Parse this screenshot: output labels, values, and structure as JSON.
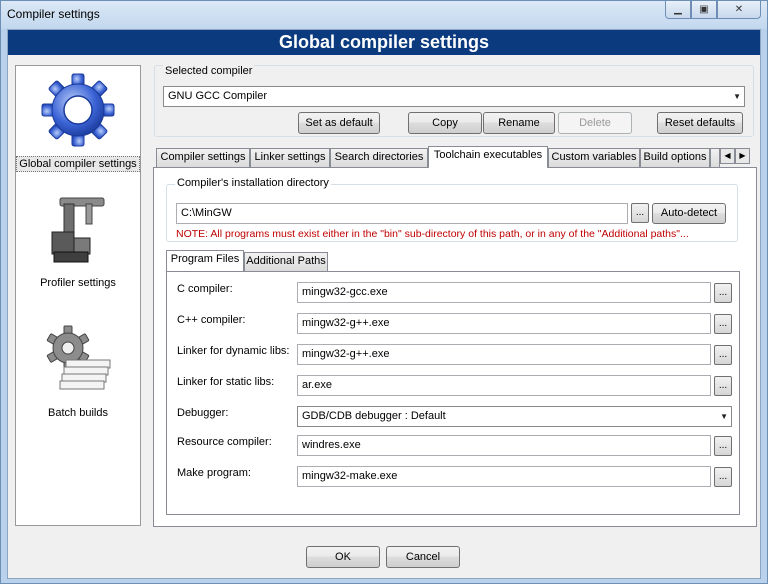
{
  "window": {
    "title": "Compiler settings"
  },
  "titlebar": {
    "minimize": "▭",
    "maximize": "□",
    "close": "✕"
  },
  "header": {
    "title": "Global compiler settings"
  },
  "sidebar": {
    "items": [
      {
        "label": "Global compiler settings",
        "icon": "gear-icon",
        "selected": true
      },
      {
        "label": "Profiler settings",
        "icon": "profiler-icon",
        "selected": false
      },
      {
        "label": "Batch builds",
        "icon": "batch-builds-icon",
        "selected": false
      }
    ]
  },
  "selected_compiler": {
    "group_label": "Selected compiler",
    "value": "GNU GCC Compiler",
    "buttons": {
      "set_default": "Set as default",
      "copy": "Copy",
      "rename": "Rename",
      "delete": "Delete",
      "reset": "Reset defaults"
    }
  },
  "tabs": [
    {
      "label": "Compiler settings",
      "active": false
    },
    {
      "label": "Linker settings",
      "active": false
    },
    {
      "label": "Search directories",
      "active": false
    },
    {
      "label": "Toolchain executables",
      "active": true
    },
    {
      "label": "Custom variables",
      "active": false
    },
    {
      "label": "Build options",
      "active": false
    }
  ],
  "install": {
    "group_label": "Compiler's installation directory",
    "path": "C:\\MinGW",
    "browse": "...",
    "autodetect": "Auto-detect",
    "note": "NOTE: All programs must exist either in the \"bin\" sub-directory of this path, or in any of the \"Additional paths\"..."
  },
  "subtabs": [
    {
      "label": "Program Files",
      "active": true
    },
    {
      "label": "Additional Paths",
      "active": false
    }
  ],
  "programs": {
    "c_compiler": {
      "label": "C compiler:",
      "value": "mingw32-gcc.exe"
    },
    "cpp_compiler": {
      "label": "C++ compiler:",
      "value": "mingw32-g++.exe"
    },
    "linker_dynamic": {
      "label": "Linker for dynamic libs:",
      "value": "mingw32-g++.exe"
    },
    "linker_static": {
      "label": "Linker for static libs:",
      "value": "ar.exe"
    },
    "debugger": {
      "label": "Debugger:",
      "value": "GDB/CDB debugger : Default"
    },
    "resource_compiler": {
      "label": "Resource compiler:",
      "value": "windres.exe"
    },
    "make_program": {
      "label": "Make program:",
      "value": "mingw32-make.exe"
    },
    "browse": "..."
  },
  "footer": {
    "ok": "OK",
    "cancel": "Cancel"
  },
  "colors": {
    "header_bg": "#0b3a7e",
    "note": "#c00000"
  }
}
